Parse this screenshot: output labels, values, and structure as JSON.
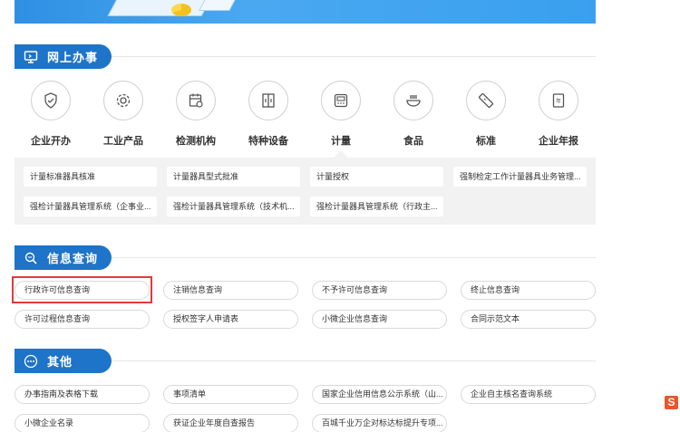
{
  "sections": {
    "online": {
      "title": "网上办事"
    },
    "query": {
      "title": "信息查询"
    },
    "other": {
      "title": "其他"
    }
  },
  "services": [
    {
      "label": "企业开办",
      "icon": "shield-icon"
    },
    {
      "label": "工业产品",
      "icon": "gear-icon"
    },
    {
      "label": "检测机构",
      "icon": "calendar-check-icon"
    },
    {
      "label": "特种设备",
      "icon": "elevator-icon"
    },
    {
      "label": "计量",
      "icon": "scale-display-icon"
    },
    {
      "label": "食品",
      "icon": "food-bowl-icon"
    },
    {
      "label": "标准",
      "icon": "ruler-icon"
    },
    {
      "label": "企业年报",
      "icon": "year-report-icon"
    }
  ],
  "selected_service": "计量",
  "metrology_items": [
    "计量标准器具核准",
    "计量器具型式批准",
    "计量授权",
    "强制检定工作计量器具业务管理...",
    "强检计量器具管理系统（企事业...",
    "强检计量器具管理系统（技术机...",
    "强检计量器具管理系统（行政主..."
  ],
  "query_items": [
    "行政许可信息查询",
    "注销信息查询",
    "不予许可信息查询",
    "终止信息查询",
    "许可过程信息查询",
    "授权签字人申请表",
    "小微企业信息查询",
    "合同示范文本"
  ],
  "other_items": [
    "办事指南及表格下载",
    "事项清单",
    "国家企业信用信息公示系统（山...",
    "企业自主核名查询系统",
    "小微企业名录",
    "获证企业年度自查报告",
    "百城千业万企对标达标提升专项..."
  ],
  "colors": {
    "accent": "#1e74c8",
    "highlight": "#e23b3b",
    "panel": "#f2f2f2"
  },
  "corner_logo": "S"
}
